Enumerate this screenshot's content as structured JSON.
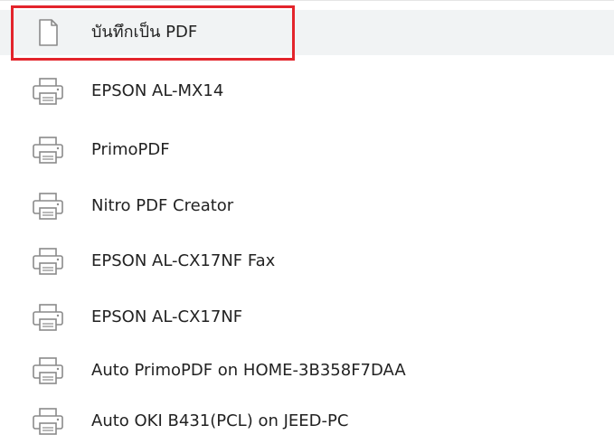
{
  "destinations": [
    {
      "label": "บันทึกเป็น PDF",
      "icon": "document-icon",
      "selected": true
    },
    {
      "label": "EPSON AL-MX14",
      "icon": "printer-icon",
      "selected": false
    },
    {
      "label": "PrimoPDF",
      "icon": "printer-icon",
      "selected": false
    },
    {
      "label": "Nitro PDF Creator",
      "icon": "printer-icon",
      "selected": false
    },
    {
      "label": "EPSON AL-CX17NF Fax",
      "icon": "printer-icon",
      "selected": false
    },
    {
      "label": "EPSON AL-CX17NF",
      "icon": "printer-icon",
      "selected": false
    },
    {
      "label": "Auto PrimoPDF on HOME-3B358F7DAA",
      "icon": "printer-icon",
      "selected": false
    },
    {
      "label": "Auto OKI B431(PCL) on JEED-PC",
      "icon": "printer-icon",
      "selected": false
    }
  ],
  "colors": {
    "highlight_border": "#e3242b",
    "selected_background": "#f1f3f4",
    "icon_stroke": "#8a8a8a",
    "text": "#222222"
  }
}
